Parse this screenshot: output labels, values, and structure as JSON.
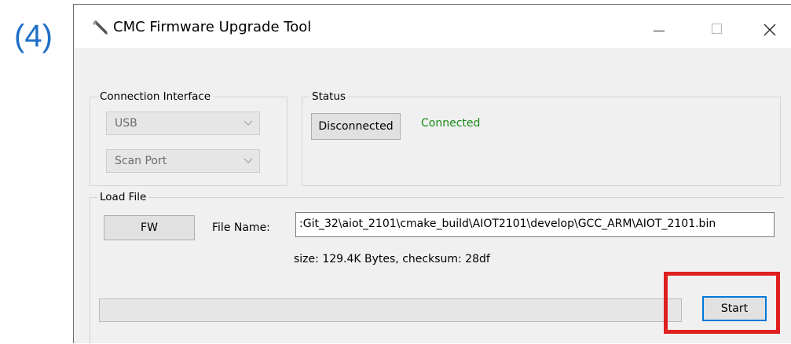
{
  "step_label": "(4)",
  "window": {
    "title": "CMC Firmware Upgrade Tool",
    "icon": "wrench-icon"
  },
  "connection": {
    "group_title": "Connection Interface",
    "interface_value": "USB",
    "port_value": "Scan Port"
  },
  "status": {
    "group_title": "Status",
    "disconnect_button": "Disconnected",
    "state_text": "Connected",
    "state_color": "#1a8a1a"
  },
  "load_file": {
    "group_title": "Load File",
    "fw_button": "FW",
    "file_name_label": "File Name:",
    "file_path": ":Git_32\\aiot_2101\\cmake_build\\AIOT2101\\develop\\GCC_ARM\\AIOT_2101.bin",
    "info": "size: 129.4K Bytes, checksum: 28df",
    "progress_percent": 0,
    "start_button": "Start"
  },
  "colors": {
    "highlight": "#e02020",
    "step_label": "#1e6fc8",
    "focus_border": "#0078d7"
  }
}
